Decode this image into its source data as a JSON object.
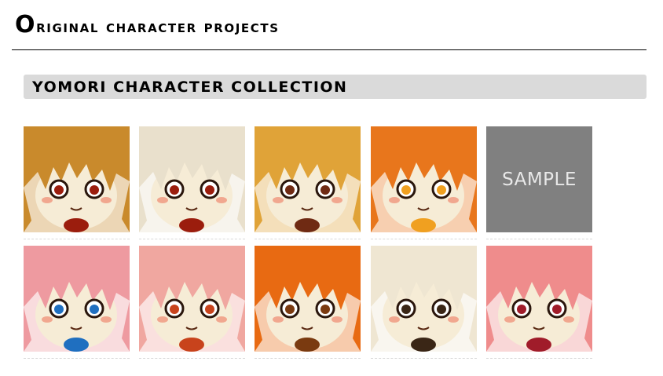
{
  "page": {
    "title_first": "O",
    "title_rest": "riginal character projects"
  },
  "section": {
    "title": "YOMORI CHARACTER COLLECTION"
  },
  "gallery": {
    "items": [
      {
        "kind": "character",
        "hair": "#c98a2c",
        "accent": "#9b1d0d"
      },
      {
        "kind": "character",
        "hair": "#e9e0cc",
        "accent": "#9b1d0d"
      },
      {
        "kind": "character",
        "hair": "#e0a338",
        "accent": "#6f2a13"
      },
      {
        "kind": "character",
        "hair": "#e8761c",
        "accent": "#f0a020"
      },
      {
        "kind": "sample",
        "label": "SAMPLE"
      },
      {
        "kind": "character",
        "hair": "#ee9aa0",
        "accent": "#1f6fc0"
      },
      {
        "kind": "character",
        "hair": "#f0a7a0",
        "accent": "#c8431c"
      },
      {
        "kind": "character",
        "hair": "#e86a12",
        "accent": "#7a3a10"
      },
      {
        "kind": "character",
        "hair": "#efe6d2",
        "accent": "#3a2616"
      },
      {
        "kind": "character",
        "hair": "#ef8c8c",
        "accent": "#a01c2a"
      }
    ]
  }
}
